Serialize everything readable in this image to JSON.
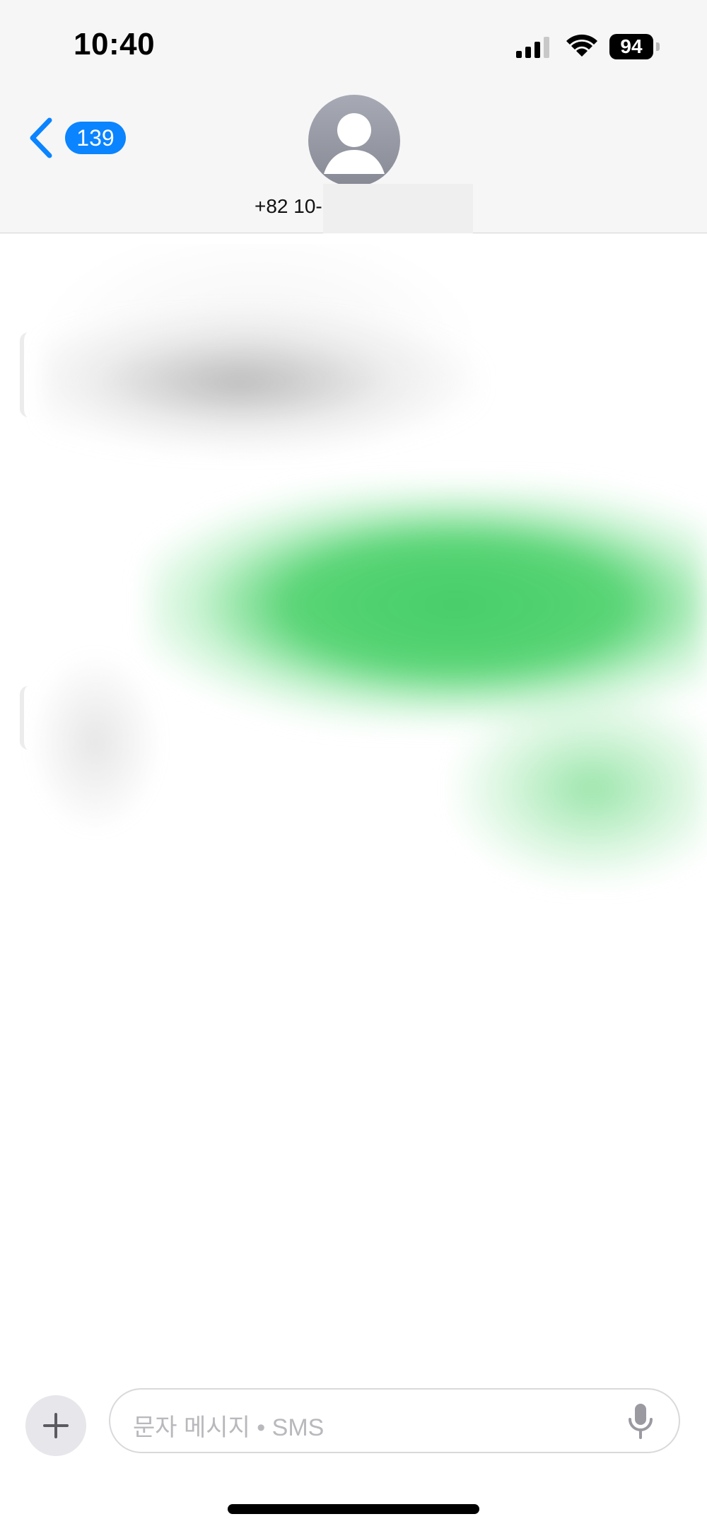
{
  "status_bar": {
    "time": "10:40",
    "battery": "94"
  },
  "header": {
    "back_badge": "139",
    "contact_number": "+82 10-"
  },
  "composer": {
    "placeholder": "문자 메시지 • SMS"
  },
  "colors": {
    "accent": "#0a84ff",
    "sent_bubble": "#4fd16f",
    "header_bg": "#f6f6f6"
  },
  "icons": {
    "back": "chevron-left-icon",
    "avatar": "person-icon",
    "add": "plus-icon",
    "mic": "microphone-icon",
    "signal": "cellular-signal-icon",
    "wifi": "wifi-icon",
    "battery": "battery-icon"
  }
}
